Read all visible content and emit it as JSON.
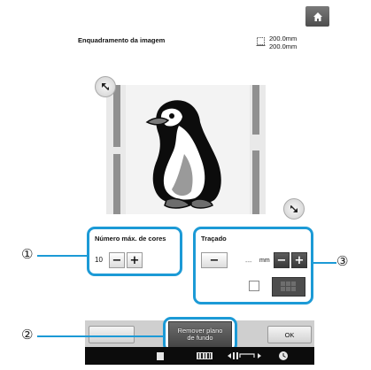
{
  "header": {
    "title": "Enquadramento da imagem",
    "width_value": "200.0mm",
    "height_value": "200.0mm"
  },
  "colors_panel": {
    "label": "Número máx. de cores",
    "value": "10",
    "minus": "−",
    "plus": "+"
  },
  "outline_panel": {
    "label": "Traçado",
    "minus": "−",
    "value": "---",
    "unit": "mm",
    "plus": "+"
  },
  "bottom": {
    "remove_bg_label_line1": "Remover plano",
    "remove_bg_label_line2": "de fundo",
    "ok_label": "OK"
  },
  "callouts": [
    "①",
    "②",
    "③"
  ],
  "colors": {
    "accent": "#1c9ad6",
    "dark_button": "#4a4a4a"
  }
}
